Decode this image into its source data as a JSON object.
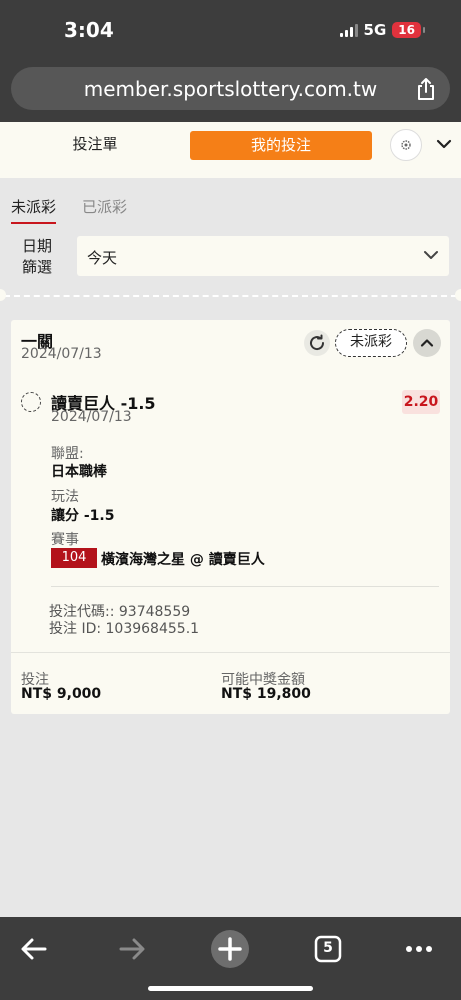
{
  "status_bar": {
    "time": "3:04",
    "network": "5G",
    "battery": "16"
  },
  "browser": {
    "url": "member.sportslottery.com.tw"
  },
  "topbar": {
    "tab_slip": "投注單",
    "tab_my_bets": "我的投注"
  },
  "filter": {
    "tabs": [
      {
        "label": "未派彩",
        "active": true
      },
      {
        "label": "已派彩",
        "active": false
      }
    ],
    "date_label": "日期篩選",
    "date_value": "今天"
  },
  "bet": {
    "type": "一關",
    "date": "2024/07/13",
    "status": "未派彩",
    "selection": {
      "name": "讀賣巨人 -1.5",
      "date": "2024/07/13",
      "odds": "2.20"
    },
    "league_label": "聯盟:",
    "league": "日本職棒",
    "play_label": "玩法",
    "play": "讓分 -1.5",
    "event_label": "賽事",
    "match_no": "104",
    "match": "橫濱海灣之星 @ 讀賣巨人",
    "code": "投注代碼:: 93748559",
    "bet_id": "投注 ID: 103968455.1",
    "stake_label": "投注",
    "stake": "NT$ 9,000",
    "payout_label": "可能中獎金額",
    "payout": "NT$ 19,800"
  },
  "toolbar": {
    "tabs_count": "5"
  },
  "colors": {
    "accent": "#f57f17",
    "red": "#c8161d",
    "chrome": "#3d3d3d",
    "card": "#fbfaf2"
  }
}
